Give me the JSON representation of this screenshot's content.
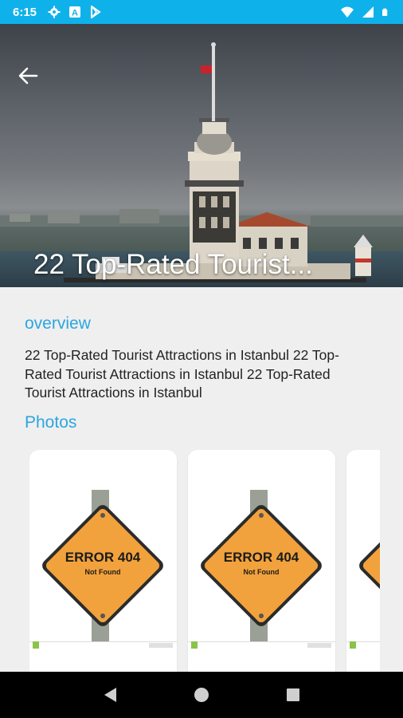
{
  "status_bar": {
    "time": "6:15",
    "icons_left": [
      "gear-icon",
      "a-box-icon",
      "play-store-icon"
    ],
    "icons_right": [
      "wifi-icon",
      "signal-icon",
      "battery-icon"
    ],
    "color": "#0fb1ea"
  },
  "hero": {
    "title": "22 Top-Rated Tourist...",
    "back_icon": "arrow-left-icon"
  },
  "overview": {
    "heading": "overview",
    "text": "22 Top-Rated Tourist Attractions in Istanbul 22 Top-Rated Tourist Attractions in Istanbul 22 Top-Rated Tourist Attractions in Istanbul"
  },
  "photos": {
    "heading": "Photos",
    "items": [
      {
        "sign_title": "ERROR 404",
        "sign_subtitle": "Not Found"
      },
      {
        "sign_title": "ERROR 404",
        "sign_subtitle": "Not Found"
      },
      {
        "sign_title": "",
        "sign_subtitle": ""
      }
    ]
  },
  "accent_color": "#2aa6e0",
  "nav_bar": {
    "buttons": [
      "back-triangle-icon",
      "home-circle-icon",
      "recents-square-icon"
    ]
  }
}
